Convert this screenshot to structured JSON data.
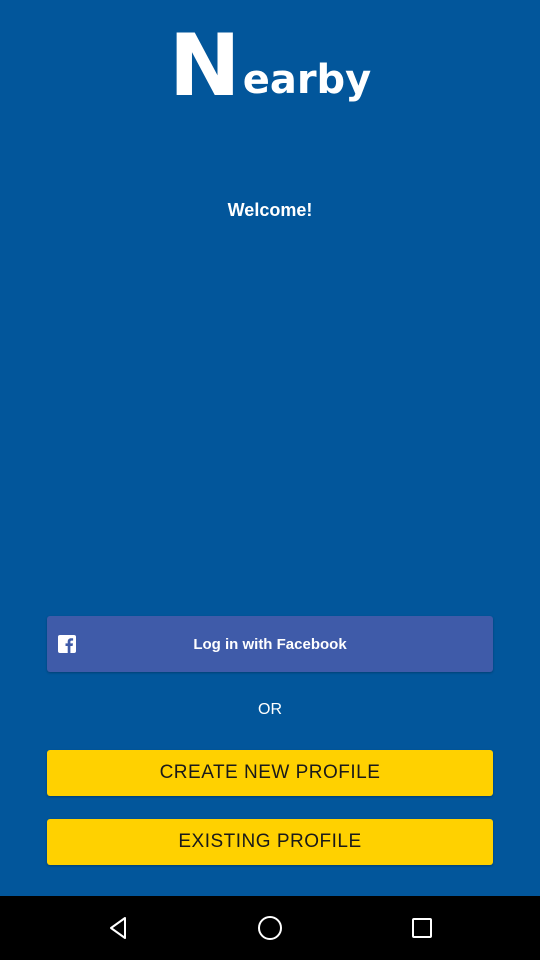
{
  "logo": {
    "big_letter": "N",
    "rest": "earby"
  },
  "welcome_text": "Welcome!",
  "facebook_button": {
    "label": "Log in with Facebook",
    "icon": "facebook-icon"
  },
  "divider_text": "OR",
  "create_button": {
    "label": "CREATE NEW PROFILE"
  },
  "existing_button": {
    "label": "EXISTING PROFILE"
  },
  "navbar": {
    "icons": [
      "back-icon",
      "home-icon",
      "recent-apps-icon"
    ]
  },
  "colors": {
    "background": "#02569B",
    "facebook": "#3F5BA9",
    "accent_yellow": "#FFD100",
    "navbar": "#000000"
  }
}
